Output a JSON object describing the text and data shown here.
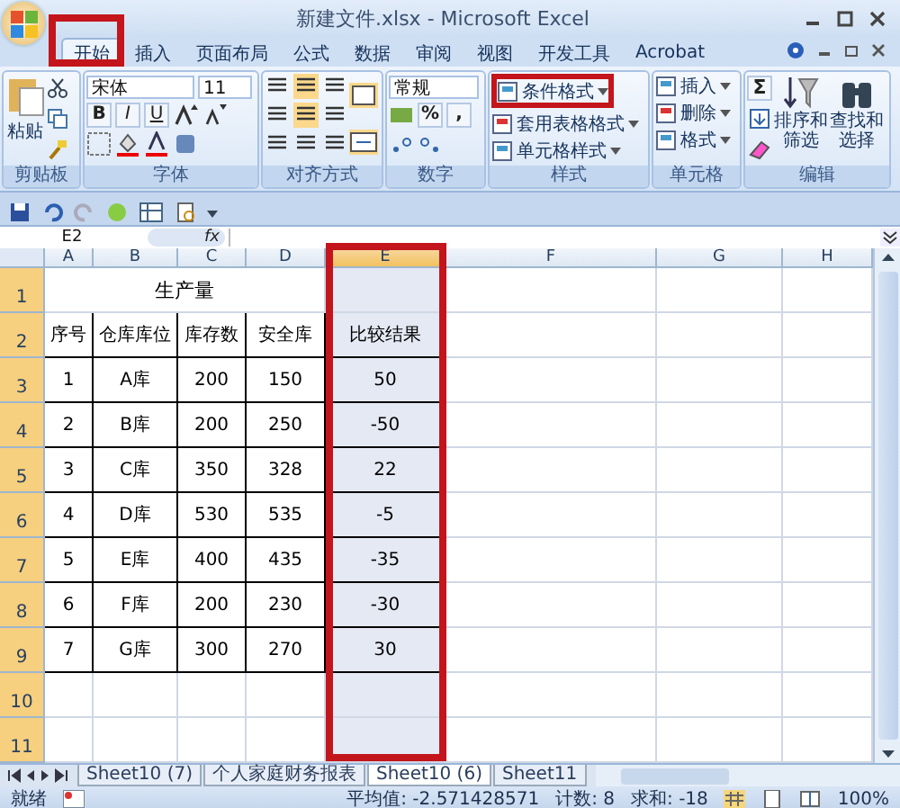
{
  "window": {
    "title": "新建文件.xlsx - Microsoft Excel"
  },
  "tabs": [
    {
      "label": "开始",
      "selected": true
    },
    {
      "label": "插入",
      "selected": false
    },
    {
      "label": "页面布局",
      "selected": false
    },
    {
      "label": "公式",
      "selected": false
    },
    {
      "label": "数据",
      "selected": false
    },
    {
      "label": "审阅",
      "selected": false
    },
    {
      "label": "视图",
      "selected": false
    },
    {
      "label": "开发工具",
      "selected": false
    },
    {
      "label": "Acrobat",
      "selected": false
    }
  ],
  "ribbon": [
    {
      "kind": "clipboard",
      "label": "剪贴板",
      "buttons": [
        "粘贴"
      ]
    },
    {
      "kind": "font",
      "label": "字体",
      "fields": [
        "宋体",
        "11"
      ],
      "buttons": [
        "B",
        "I",
        "U"
      ]
    },
    {
      "kind": "align",
      "label": "对齐方式"
    },
    {
      "kind": "number",
      "label": "数字",
      "fields": [
        "常规"
      ],
      "buttons": [
        "%",
        ","
      ]
    },
    {
      "kind": "styles",
      "label": "样式",
      "buttons": [
        "条件格式",
        "套用表格格式",
        "单元格样式"
      ]
    },
    {
      "kind": "cells",
      "label": "单元格",
      "buttons": [
        "插入",
        "删除",
        "格式"
      ]
    },
    {
      "kind": "editing",
      "label": "编辑",
      "buttons": [
        "Σ",
        "排序和筛选",
        "查找和选择"
      ]
    }
  ],
  "formula_bar": {
    "name_box": "E2",
    "fx": "fx"
  },
  "sheet": {
    "columns": [
      {
        "label": "A",
        "selected": false
      },
      {
        "label": "B",
        "selected": false
      },
      {
        "label": "C",
        "selected": false
      },
      {
        "label": "D",
        "selected": false
      },
      {
        "label": "E",
        "selected": true
      },
      {
        "label": "F",
        "selected": false
      },
      {
        "label": "G",
        "selected": false
      },
      {
        "label": "H",
        "selected": false
      }
    ],
    "rows": [
      {
        "header": "1",
        "selected": true,
        "title": "生产量"
      },
      {
        "header": "2",
        "selected": true,
        "cells": [
          "序号",
          "仓库库位",
          "库存数",
          "安全库",
          "比较结果"
        ]
      },
      {
        "header": "3",
        "selected": true,
        "cells": [
          "1",
          "A库",
          "200",
          "150",
          "50"
        ]
      },
      {
        "header": "4",
        "selected": true,
        "cells": [
          "2",
          "B库",
          "200",
          "250",
          "-50"
        ]
      },
      {
        "header": "5",
        "selected": true,
        "cells": [
          "3",
          "C库",
          "350",
          "328",
          "22"
        ]
      },
      {
        "header": "6",
        "selected": true,
        "cells": [
          "4",
          "D库",
          "530",
          "535",
          "-5"
        ]
      },
      {
        "header": "7",
        "selected": true,
        "cells": [
          "5",
          "E库",
          "400",
          "435",
          "-35"
        ]
      },
      {
        "header": "8",
        "selected": true,
        "cells": [
          "6",
          "F库",
          "200",
          "230",
          "-30"
        ]
      },
      {
        "header": "9",
        "selected": true,
        "cells": [
          "7",
          "G库",
          "300",
          "270",
          "30"
        ]
      },
      {
        "header": "10",
        "selected": true
      },
      {
        "header": "11",
        "selected": true
      }
    ]
  },
  "sheet_tabs": [
    {
      "label": "Sheet10 (7)",
      "selected": false
    },
    {
      "label": "个人家庭财务报表",
      "selected": false
    },
    {
      "label": "Sheet10 (6)",
      "selected": true
    },
    {
      "label": "Sheet11",
      "selected": false
    }
  ],
  "status_bar": {
    "state": "就绪",
    "average": "平均值: -2.571428571",
    "count": "计数: 8",
    "sum": "求和: -18",
    "zoom": "100%"
  }
}
